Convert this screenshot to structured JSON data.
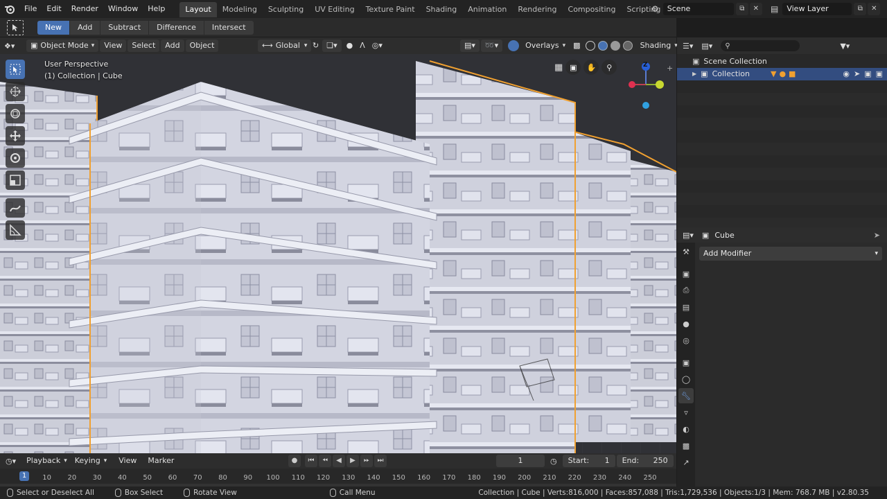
{
  "topbar": {
    "menu": [
      "File",
      "Edit",
      "Render",
      "Window",
      "Help"
    ],
    "workspaces": [
      "Layout",
      "Modeling",
      "Sculpting",
      "UV Editing",
      "Texture Paint",
      "Shading",
      "Animation",
      "Rendering",
      "Compositing",
      "Scripting"
    ],
    "active_workspace": "Layout",
    "scene": "Scene",
    "view_layer": "View Layer"
  },
  "tool_settings": {
    "buttons": [
      "New",
      "Add",
      "Subtract",
      "Difference",
      "Intersect"
    ]
  },
  "viewport_header": {
    "mode": "Object Mode",
    "view": "View",
    "select": "Select",
    "add": "Add",
    "object": "Object",
    "orientation": "Global",
    "overlays": "Overlays",
    "shading": "Shading"
  },
  "viewport": {
    "perspective": "User Perspective",
    "context": "(1) Collection | Cube",
    "gizmo": {
      "z": "Z"
    }
  },
  "outliner": {
    "scene_collection": "Scene Collection",
    "collection": "Collection"
  },
  "properties": {
    "object_name": "Cube",
    "add_modifier": "Add Modifier"
  },
  "timeline": {
    "playback": "Playback",
    "keying": "Keying",
    "view": "View",
    "marker": "Marker",
    "current_frame": "1",
    "start_label": "Start:",
    "start": "1",
    "end_label": "End:",
    "end": "250",
    "ticks": [
      "10",
      "20",
      "30",
      "40",
      "50",
      "60",
      "70",
      "80",
      "90",
      "100",
      "110",
      "120",
      "130",
      "140",
      "150",
      "160",
      "170",
      "180",
      "190",
      "200",
      "210",
      "220",
      "230",
      "240",
      "250"
    ],
    "frame_marker": "1"
  },
  "statusbar": {
    "select": "Select or Deselect All",
    "box_select": "Box Select",
    "rotate": "Rotate View",
    "call_menu": "Call Menu",
    "stats": "Collection | Cube | Verts:816,000 | Faces:857,088 | Tris:1,729,536 | Objects:1/3 | Mem: 768.7 MB | v2.80.35"
  },
  "colors": {
    "accent": "#4772b3",
    "building": "#d9dbe6",
    "shadow": "#8a8c9c",
    "outline": "#f0a030"
  }
}
